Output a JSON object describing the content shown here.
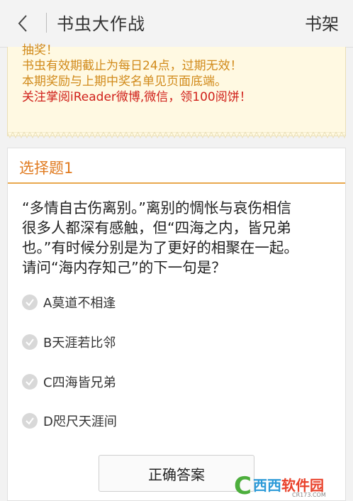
{
  "header": {
    "title": "书虫大作战",
    "shelf_label": "书架"
  },
  "notice": {
    "line0": "抽奖！",
    "line1": "书虫有效期截止为每日24点，过期无效！",
    "line2": "本期奖励与上期中奖名单见页面底端。",
    "line3": "关注掌阅iReader微博,微信，领100阅饼！"
  },
  "question": {
    "title": "选择题1",
    "lines": [
      "“多情自古伤离别。”离别的惆怅与哀伤相信",
      "很多人都深有感触，但“四海之内，皆兄弟",
      "也。”有时候分别是为了更好的相聚在一起。",
      "请问“海内存知己”的下一句是？"
    ],
    "options": [
      {
        "label": "A莫道不相逢"
      },
      {
        "label": "B天涯若比邻"
      },
      {
        "label": "C四海皆兄弟"
      },
      {
        "label": "D咫尺天涯间"
      }
    ],
    "answer_button": "正确答案"
  },
  "watermark": {
    "brand_a": "西西",
    "brand_b": "软件园",
    "domain": "CR173.COM"
  },
  "colors": {
    "accent_orange": "#e07a1f",
    "notice_orange": "#d18a1a",
    "notice_red": "#d0201a"
  }
}
